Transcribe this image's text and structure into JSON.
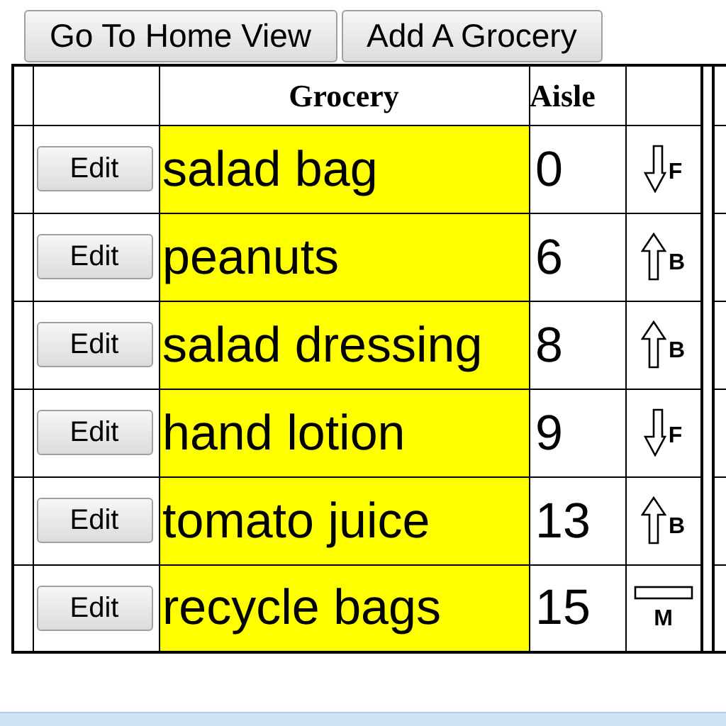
{
  "toolbar": {
    "buttons": [
      "Go To Home View",
      "Add A Grocery"
    ]
  },
  "table": {
    "columns": [
      "Grocery",
      "Aisle"
    ],
    "rows": [
      {
        "action": "Edit",
        "grocery": "salad bag",
        "aisle": "0",
        "location": {
          "kind": "down",
          "letter": "F"
        }
      },
      {
        "action": "Edit",
        "grocery": "peanuts",
        "aisle": "6",
        "location": {
          "kind": "up",
          "letter": "B"
        }
      },
      {
        "action": "Edit",
        "grocery": "salad dressing",
        "aisle": "8",
        "location": {
          "kind": "up",
          "letter": "B"
        }
      },
      {
        "action": "Edit",
        "grocery": "hand lotion",
        "aisle": "9",
        "location": {
          "kind": "down",
          "letter": "F"
        }
      },
      {
        "action": "Edit",
        "grocery": "tomato juice",
        "aisle": "13",
        "location": {
          "kind": "up",
          "letter": "B"
        }
      },
      {
        "action": "Edit",
        "grocery": "recycle bags",
        "aisle": "15",
        "location": {
          "kind": "bar",
          "letter": "M"
        }
      }
    ]
  }
}
